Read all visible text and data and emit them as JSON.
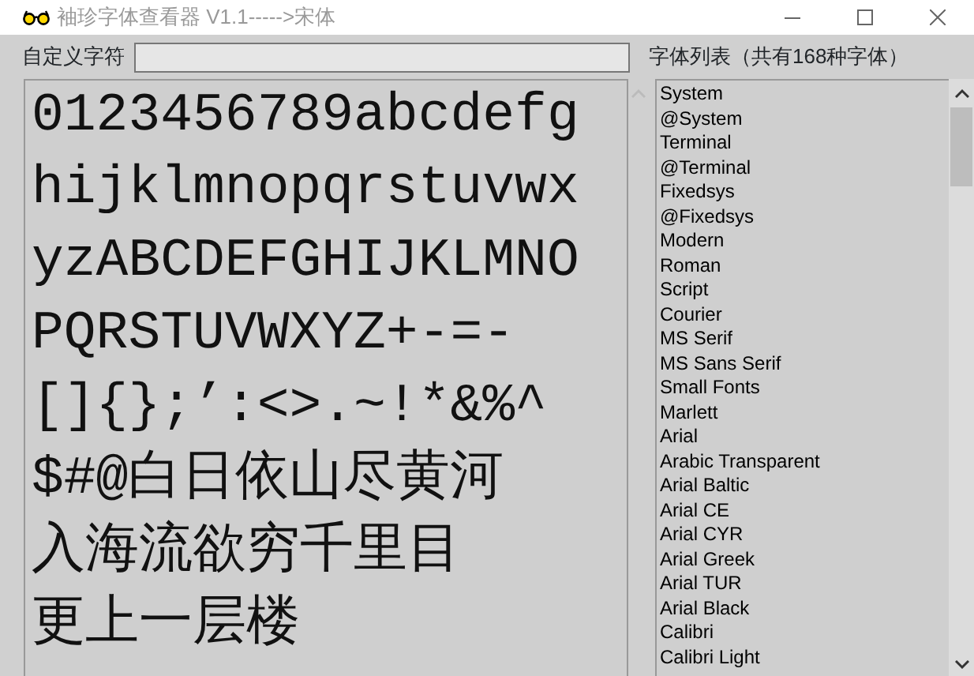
{
  "window": {
    "title": "袖珍字体查看器 V1.1----->宋体"
  },
  "custom_chars": {
    "label": "自定义字符"
  },
  "font_list": {
    "heading": "字体列表（共有168种字体）",
    "items": [
      {
        "name": "System"
      },
      {
        "name": "@System"
      },
      {
        "name": "Terminal"
      },
      {
        "name": "@Terminal"
      },
      {
        "name": "Fixedsys"
      },
      {
        "name": "@Fixedsys"
      },
      {
        "name": "Modern"
      },
      {
        "name": "Roman"
      },
      {
        "name": "Script"
      },
      {
        "name": "Courier"
      },
      {
        "name": "MS Serif"
      },
      {
        "name": "MS Sans Serif"
      },
      {
        "name": "Small Fonts"
      },
      {
        "name": "Marlett"
      },
      {
        "name": "Arial"
      },
      {
        "name": "Arabic Transparent"
      },
      {
        "name": "Arial Baltic"
      },
      {
        "name": "Arial CE"
      },
      {
        "name": "Arial CYR"
      },
      {
        "name": "Arial Greek"
      },
      {
        "name": "Arial TUR"
      },
      {
        "name": "Arial Black"
      },
      {
        "name": "Calibri"
      },
      {
        "name": "Calibri Light"
      }
    ]
  },
  "preview": {
    "lines": [
      "0123456789abcdefg",
      "hijklmnopqrstuvwx",
      "yzABCDEFGHIJKLMNO",
      "PQRSTUVWXYZ+-=-",
      "[]{};’:<>.~!*&%^",
      "$#@白日依山尽黄河",
      "入海流欲穷千里目",
      "更上一层楼"
    ]
  }
}
